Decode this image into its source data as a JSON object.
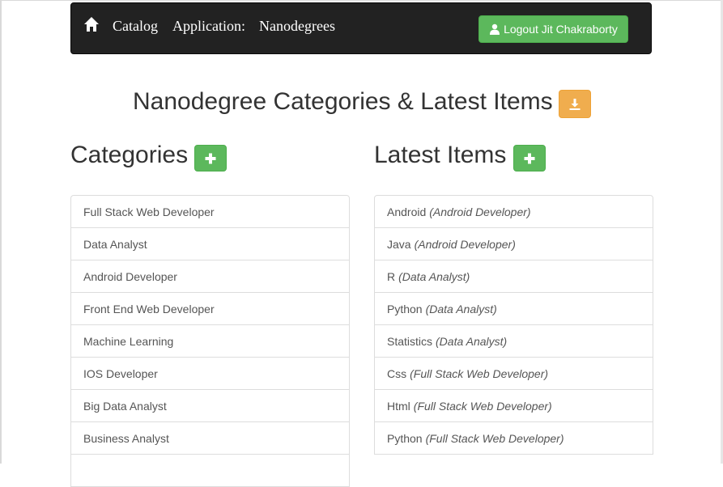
{
  "nav": {
    "home_icon": "home-icon",
    "links": [
      "Catalog",
      "Application:",
      "Nanodegrees"
    ],
    "logout_label": "Logout Jit Chakraborty",
    "user_icon": "user-icon"
  },
  "page": {
    "title": "Nanodegree Categories & Latest Items",
    "download_icon": "download-icon"
  },
  "categories": {
    "title": "Categories",
    "add_icon": "plus-icon",
    "items": [
      "Full Stack Web Developer",
      "Data Analyst",
      "Android Developer",
      "Front End Web Developer",
      "Machine Learning",
      "IOS Developer",
      "Big Data Analyst",
      "Business Analyst",
      ""
    ]
  },
  "latest": {
    "title": "Latest Items",
    "add_icon": "plus-icon",
    "items": [
      {
        "name": "Android",
        "category": "(Android Developer)"
      },
      {
        "name": "Java",
        "category": "(Android Developer)"
      },
      {
        "name": "R",
        "category": "(Data Analyst)"
      },
      {
        "name": "Python",
        "category": "(Data Analyst)"
      },
      {
        "name": "Statistics",
        "category": "(Data Analyst)"
      },
      {
        "name": "Css",
        "category": "(Full Stack Web Developer)"
      },
      {
        "name": "Html",
        "category": "(Full Stack Web Developer)"
      },
      {
        "name": "Python",
        "category": "(Full Stack Web Developer)"
      }
    ]
  },
  "colors": {
    "navbar": "#222222",
    "success": "#5cb85c",
    "warning": "#f0ad4e",
    "border": "#dddddd"
  }
}
